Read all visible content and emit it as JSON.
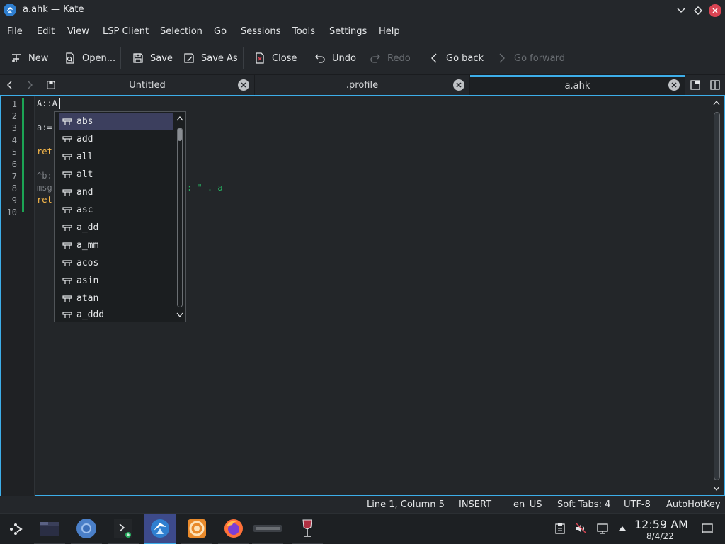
{
  "window": {
    "title": "a.ahk — Kate"
  },
  "menubar": [
    "File",
    "Edit",
    "View",
    "LSP Client",
    "Selection",
    "Go",
    "Sessions",
    "Tools",
    "Settings",
    "Help"
  ],
  "toolbar": {
    "new": "New",
    "open": "Open...",
    "save": "Save",
    "save_as": "Save As",
    "close": "Close",
    "undo": "Undo",
    "redo": "Redo",
    "go_back": "Go back",
    "go_forward": "Go forward"
  },
  "tabs": [
    {
      "label": "Untitled",
      "active": false
    },
    {
      "label": ".profile",
      "active": false
    },
    {
      "label": "a.ahk",
      "active": true
    }
  ],
  "editor": {
    "line_numbers": [
      "1",
      "2",
      "3",
      "4",
      "5",
      "6",
      "7",
      "8",
      "9",
      "10"
    ],
    "lines": {
      "l1": "A::A",
      "l3": "a:=",
      "l5": "ret",
      "l7": "^b:",
      "l8a": "msg",
      "l8b": ": \" . a",
      "l9": "ret"
    }
  },
  "completion": {
    "items": [
      "abs",
      "add",
      "all",
      "alt",
      "and",
      "asc",
      "a_dd",
      "a_mm",
      "acos",
      "asin",
      "atan",
      "a_ddd"
    ],
    "selected": "abs"
  },
  "status": {
    "position": "Line 1, Column 5",
    "mode": "INSERT",
    "dictionary": "en_US",
    "indent": "Soft Tabs: 4",
    "encoding": "UTF-8",
    "syntax": "AutoHotKey"
  },
  "taskbar": {
    "time": "12:59 AM",
    "date": "8/4/22",
    "icons": [
      "app-launcher-icon",
      "file-manager-icon",
      "chromium-icon",
      "terminal-icon",
      "kate-icon",
      "app-icon-orange",
      "firefox-icon",
      "google-icon",
      "wine-icon"
    ]
  },
  "colors": {
    "accent": "#3daee9",
    "selection": "#3c3f5e",
    "modified_line": "#1ca454",
    "close_button": "#da4453"
  }
}
